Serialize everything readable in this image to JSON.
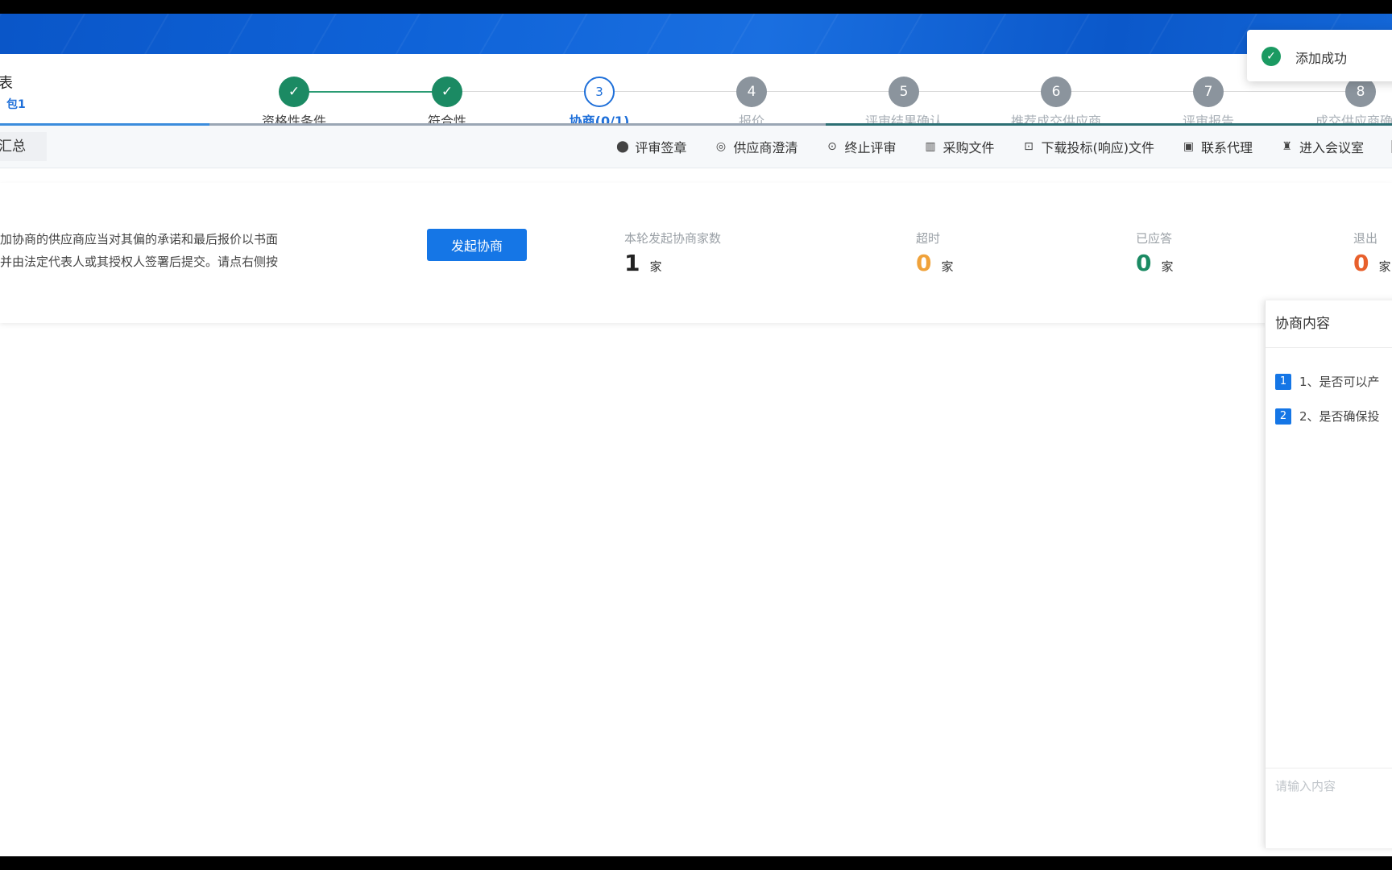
{
  "header": {
    "title": "表",
    "subtitle": "包1"
  },
  "steps": [
    {
      "number": "1",
      "label": "资格性条件",
      "status": "done"
    },
    {
      "number": "2",
      "label": "符合性",
      "status": "done"
    },
    {
      "number": "3",
      "label": "协商(0/1)",
      "status": "active"
    },
    {
      "number": "4",
      "label": "报价",
      "status": "pending"
    },
    {
      "number": "5",
      "label": "评审结果确认",
      "status": "pending"
    },
    {
      "number": "6",
      "label": "推荐成交供应商",
      "status": "pending"
    },
    {
      "number": "7",
      "label": "评审报告",
      "status": "pending"
    },
    {
      "number": "8",
      "label": "成交供应商确认",
      "status": "pending"
    }
  ],
  "toolbar": {
    "crumb": "汇总",
    "items": [
      {
        "label": "评审签章",
        "icon": "pin-icon"
      },
      {
        "label": "供应商澄清",
        "icon": "shield-icon"
      },
      {
        "label": "终止评审",
        "icon": "stop-icon"
      },
      {
        "label": "采购文件",
        "icon": "document-icon"
      },
      {
        "label": "下载投标(响应)文件",
        "icon": "download-icon"
      },
      {
        "label": "联系代理",
        "icon": "contact-icon"
      },
      {
        "label": "进入会议室",
        "icon": "meeting-icon"
      }
    ]
  },
  "negotiation": {
    "notice_line1": "加协商的供应商应当对其偏的承诺和最后报价以书面",
    "notice_line2": "并由法定代表人或其授权人签署后提交。请点右侧按",
    "start_button": "发起协商",
    "stats": [
      {
        "label": "本轮发起协商家数",
        "value": "1",
        "unit": "家",
        "color": "#222222"
      },
      {
        "label": "超时",
        "value": "0",
        "unit": "家",
        "color": "#f0a23a"
      },
      {
        "label": "已应答",
        "value": "0",
        "unit": "家",
        "color": "#1b8a63"
      },
      {
        "label": "退出",
        "value": "0",
        "unit": "家",
        "color": "#e8602c"
      }
    ]
  },
  "panel": {
    "title": "协商内容",
    "items": [
      {
        "badge": "1",
        "text": "1、是否可以产"
      },
      {
        "badge": "2",
        "text": "2、是否确保投"
      }
    ],
    "input_placeholder": "请输入内容"
  },
  "toast": {
    "message": "添加成功"
  },
  "colors": {
    "primary": "#1576e6",
    "done": "#1b8a63",
    "banner": "#0f63d8"
  }
}
